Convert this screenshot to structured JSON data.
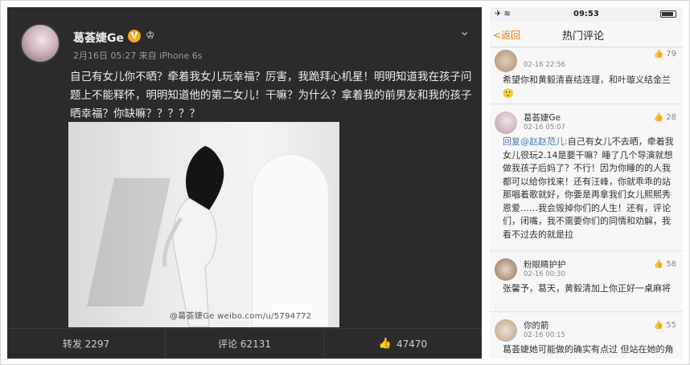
{
  "post": {
    "username": "葛荟婕Ge",
    "verified_badge": "V",
    "meta": "2月16日 05:27 来自 iPhone 6s",
    "text": "自己有女儿你不晒？牵着我女儿玩幸福？厉害，我跪拜心机星！明明知道我在孩子问题上不能释怀，明明知道他的第二女儿！干嘛？为什么？拿着我的前男友和我的孩子晒幸福？你缺嘛？？？？？",
    "watermark": "@葛荟婕Ge   weibo.com/u/5794772",
    "repost_label": "转发 2297",
    "comment_label": "评论 62131",
    "like_count": "47470"
  },
  "phone": {
    "time": "09:53",
    "back_label": "返回",
    "title": "热门评论",
    "comments": [
      {
        "name": "",
        "time": "02-16 22:56",
        "likes": "79",
        "text": "希望你和黄毅清喜结连理，和叶璇义结金兰"
      },
      {
        "name": "葛荟婕Ge",
        "time": "02-16 05:07",
        "likes": "28",
        "mention": "回复@赵赵范儿:",
        "text": "自己有女儿不去晒，牵着我女儿很玩2.14是要干嘛？睡了几个导演就想做我孩子后妈了？不行！因为你睡的的人我都可以给你找来！还有汪峰，你就乖乖的站那唱着歌就好，你要是再拿我们女儿熙熙秀恩爱……我会毁掉你们的人生！还有，评论们，闭嘴，我不需要你们的同情和劝解，我看不过去的就是拉"
      },
      {
        "name": "粉眼睛护护",
        "time": "02-16 00:30",
        "likes": "58",
        "text": "张馨予，葛天，黄毅清加上你正好一桌麻将"
      },
      {
        "name": "你的箭",
        "time": "02-16 00:15",
        "likes": "55",
        "text": "葛荟婕她可能做的确实有点过 但站在她的角度上我也可以体谅她"
      }
    ]
  },
  "colors": {
    "accent": "#e87d0d",
    "mention": "#4a74b8",
    "badge": "#f6a623"
  }
}
